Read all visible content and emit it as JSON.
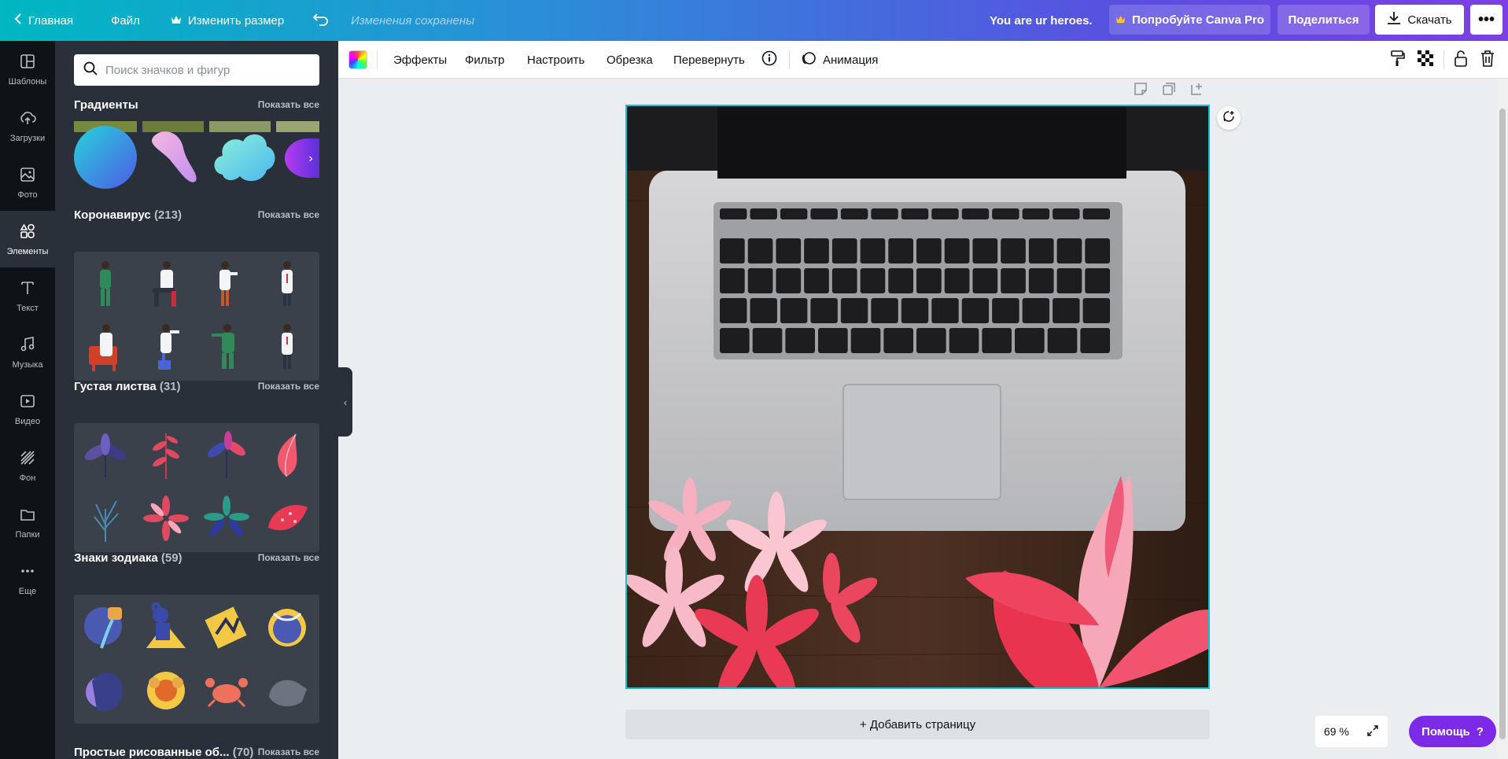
{
  "topbar": {
    "home_label": "Главная",
    "file_label": "Файл",
    "resize_label": "Изменить размер",
    "save_status": "Изменения сохранены",
    "doc_title": "You are ur heroes.",
    "try_pro_label": "Попробуйте Canva Pro",
    "share_label": "Поделиться",
    "download_label": "Скачать"
  },
  "rail": {
    "items": [
      {
        "label": "Шаблоны",
        "icon": "templates-icon"
      },
      {
        "label": "Загрузки",
        "icon": "upload-icon"
      },
      {
        "label": "Фото",
        "icon": "photo-icon"
      },
      {
        "label": "Элементы",
        "icon": "elements-icon"
      },
      {
        "label": "Текст",
        "icon": "text-icon"
      },
      {
        "label": "Музыка",
        "icon": "music-icon"
      },
      {
        "label": "Видео",
        "icon": "video-icon"
      },
      {
        "label": "Фон",
        "icon": "background-icon"
      },
      {
        "label": "Папки",
        "icon": "folder-icon"
      },
      {
        "label": "Еще",
        "icon": "more-icon"
      }
    ]
  },
  "panel": {
    "search_placeholder": "Поиск значков и фигур",
    "show_all": "Показать все",
    "sections": [
      {
        "title": "Градиенты",
        "count": ""
      },
      {
        "title": "Коронавирус",
        "count": "(213)"
      },
      {
        "title": "Густая листва",
        "count": "(31)"
      },
      {
        "title": "Знаки зодиака",
        "count": "(59)"
      },
      {
        "title": "Простые рисованные об...",
        "count": "(70)"
      }
    ]
  },
  "toolbar": {
    "effects": "Эффекты",
    "filter": "Фильтр",
    "adjust": "Настроить",
    "crop": "Обрезка",
    "flip": "Перевернуть",
    "animate": "Анимация"
  },
  "canvas": {
    "add_page": "+ Добавить страницу",
    "zoom": "69 %",
    "help": "Помощь",
    "help_mark": "?"
  },
  "colors": {
    "accent": "#7d2ae8",
    "selection": "#13c3d4",
    "panel_bg": "#293039",
    "rail_bg": "#0e1318"
  }
}
